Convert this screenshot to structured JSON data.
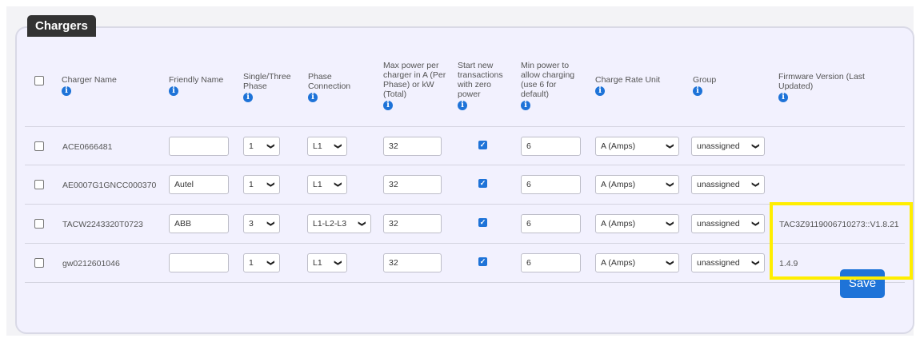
{
  "panel": {
    "title": "Chargers"
  },
  "headers": {
    "charger_name": "Charger Name",
    "friendly_name": "Friendly Name",
    "phase": "Single/Three Phase",
    "phase_connection": "Phase Connection",
    "max_power": "Max power per charger in A (Per Phase) or kW (Total)",
    "start_zero": "Start new transactions with zero power",
    "min_power": "Min power to allow charging (use 6 for default)",
    "rate_unit": "Charge Rate Unit",
    "group": "Group",
    "firmware": "Firmware Version (Last Updated)"
  },
  "info_glyph": "i",
  "chevron": "❯",
  "check_glyph": "✓",
  "rows": [
    {
      "name": "ACE0666481",
      "friendly": "",
      "phase": "1",
      "connection": "L1",
      "max_power": "32",
      "zero_power": true,
      "min_power": "6",
      "rate_unit": "A (Amps)",
      "group": "unassigned",
      "firmware": ""
    },
    {
      "name": "AE0007G1GNCC000370",
      "friendly": "Autel",
      "phase": "1",
      "connection": "L1",
      "max_power": "32",
      "zero_power": true,
      "min_power": "6",
      "rate_unit": "A (Amps)",
      "group": "unassigned",
      "firmware": ""
    },
    {
      "name": "TACW2243320T0723",
      "friendly": "ABB",
      "phase": "3",
      "connection": "L1-L2-L3",
      "max_power": "32",
      "zero_power": true,
      "min_power": "6",
      "rate_unit": "A (Amps)",
      "group": "unassigned",
      "firmware": "TAC3Z9119006710273::V1.8.21"
    },
    {
      "name": "gw0212601046",
      "friendly": "",
      "phase": "1",
      "connection": "L1",
      "max_power": "32",
      "zero_power": true,
      "min_power": "6",
      "rate_unit": "A (Amps)",
      "group": "unassigned",
      "firmware": "1.4.9"
    }
  ],
  "actions": {
    "save": "Save"
  },
  "colors": {
    "accent": "#1e73d8",
    "highlight": "#ffee00",
    "tab": "#333333",
    "panel": "#f2f1fe"
  }
}
